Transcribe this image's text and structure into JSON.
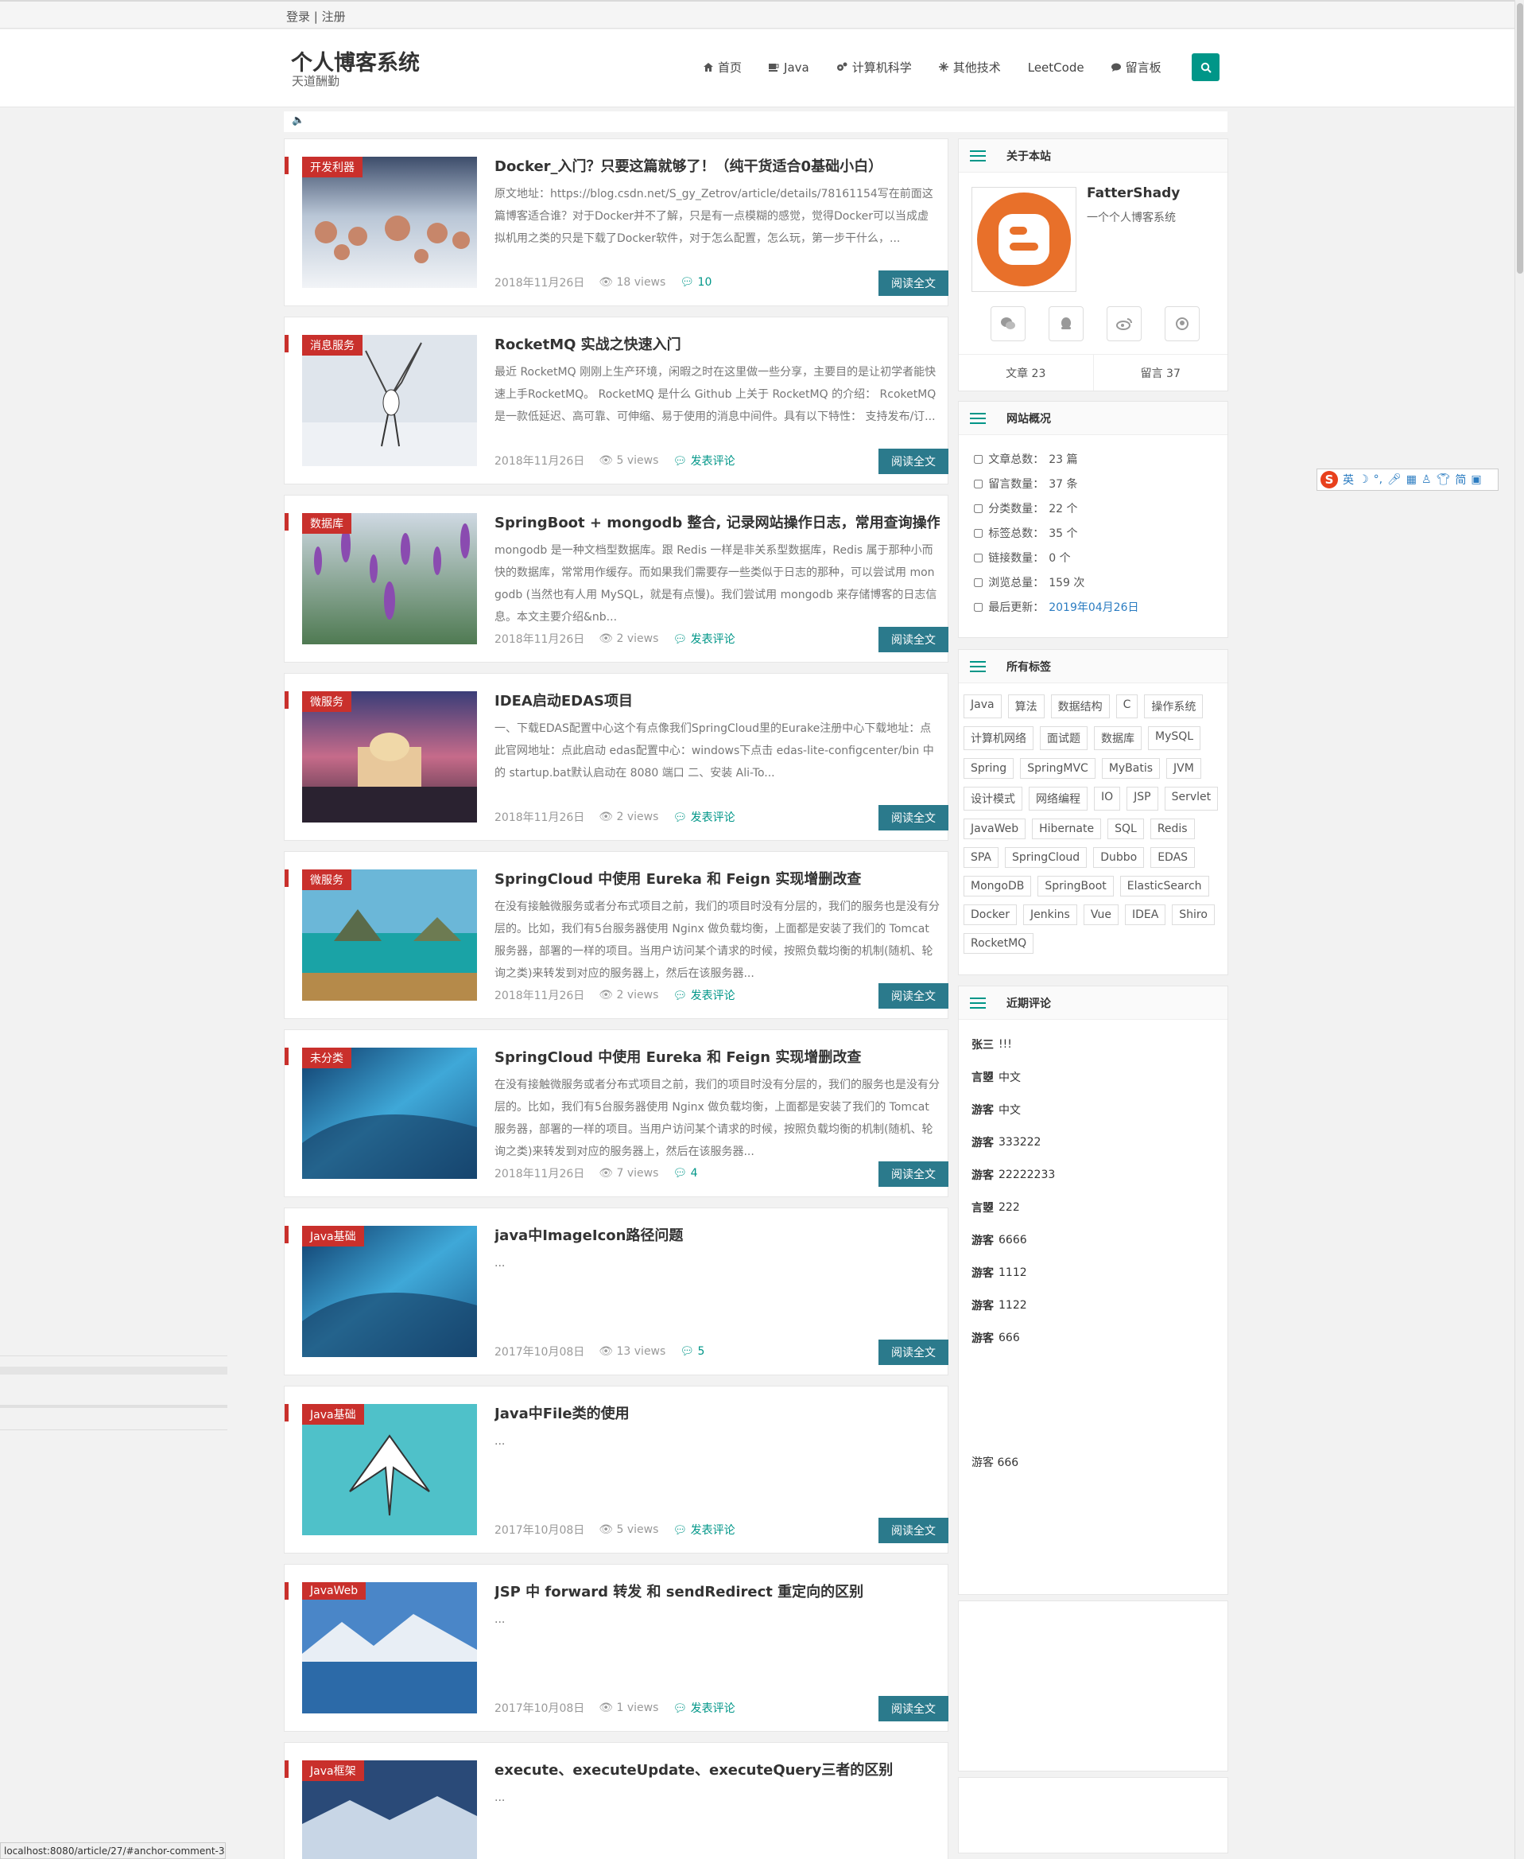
{
  "topbar": {
    "login": "登录",
    "sep": " | ",
    "register": "注册"
  },
  "header": {
    "title": "个人博客系统",
    "subtitle": "天道酬勤"
  },
  "nav": [
    {
      "label": "首页",
      "icon": "home-icon"
    },
    {
      "label": "Java",
      "icon": "coffee-icon"
    },
    {
      "label": "计算机科学",
      "icon": "gears-icon"
    },
    {
      "label": "其他技术",
      "icon": "snowflake-icon"
    },
    {
      "label": "LeetCode",
      "icon": ""
    },
    {
      "label": "留言板",
      "icon": "comment-icon"
    }
  ],
  "posts": [
    {
      "tag": "开发利器",
      "title": "Docker_入门？只要这篇就够了！（纯干货适合0基础小白）",
      "excerpt": "原文地址：https://blog.csdn.net/S_gy_Zetrov/article/details/78161154写在前面这篇博客适合谁？对于Docker并不了解，只是有一点模糊的感觉，觉得Docker可以当成虚拟机用之类的只是下载了Docker软件，对于怎么配置，怎么玩，第一步干什么，...",
      "date": "2018年11月26日",
      "views": "18 views",
      "comments": "10",
      "read": "阅读全文",
      "img": "snowtrees"
    },
    {
      "tag": "消息服务",
      "title": "RocketMQ 实战之快速入门",
      "excerpt": "最近 RocketMQ 刚刚上生产环境，闲暇之时在这里做一些分享，主要目的是让初学者能快速上手RocketMQ。 RocketMQ 是什么 Github 上关于 RocketMQ 的介绍： RcoketMQ 是一款低延迟、高可靠、可伸缩、易于使用的消息中间件。具有以下特性： 支持发布/订...",
      "date": "2018年11月26日",
      "views": "5 views",
      "comments": "发表评论",
      "read": "阅读全文",
      "img": "crane"
    },
    {
      "tag": "数据库",
      "title": "SpringBoot + mongodb 整合, 记录网站操作日志，常用查询操作",
      "excerpt": "mongodb 是一种文档型数据库。跟 Redis 一样是非关系型数据库，Redis 属于那种小而快的数据库，常常用作缓存。而如果我们需要存一些类似于日志的那种，可以尝试用 mongodb (当然也有人用 MySQL，就是有点慢)。我们尝试用 mongodb 来存储博客的日志信息。本文主要介绍&nb...",
      "date": "2018年11月26日",
      "views": "2 views",
      "comments": "发表评论",
      "read": "阅读全文",
      "img": "lavender"
    },
    {
      "tag": "微服务",
      "title": "IDEA启动EDAS项目",
      "excerpt": "一、下载EDAS配置中心这个有点像我们SpringCloud里的Eurake注册中心下载地址：点此官网地址：点此启动 edas配置中心：windows下点击 edas-lite-configcenter/bin 中的 startup.bat默认启动在 8080 端口 二、安装 Ali-To...",
      "date": "2018年11月26日",
      "views": "2 views",
      "comments": "发表评论",
      "read": "阅读全文",
      "img": "city"
    },
    {
      "tag": "微服务",
      "title": "SpringCloud 中使用 Eureka 和 Feign 实现增删改查",
      "excerpt": "在没有接触微服务或者分布式项目之前，我们的项目时没有分层的，我们的服务也是没有分层的。比如，我们有5台服务器使用 Nginx 做负载均衡，上面都是安装了我们的 Tomcat 服务器，部署的一样的项目。当用户访问某个请求的时候，按照负载均衡的机制(随机、轮询之类)来转发到对应的服务器上，然后在该服务器...",
      "date": "2018年11月26日",
      "views": "2 views",
      "comments": "发表评论",
      "read": "阅读全文",
      "img": "bay"
    },
    {
      "tag": "未分类",
      "title": "SpringCloud 中使用 Eureka 和 Feign 实现增删改查",
      "excerpt": "在没有接触微服务或者分布式项目之前，我们的项目时没有分层的，我们的服务也是没有分层的。比如，我们有5台服务器使用 Nginx 做负载均衡，上面都是安装了我们的 Tomcat 服务器，部署的一样的项目。当用户访问某个请求的时候，按照负载均衡的机制(随机、轮询之类)来转发到对应的服务器上，然后在该服务器...",
      "date": "2018年11月26日",
      "views": "7 views",
      "comments": "4",
      "read": "阅读全文",
      "img": "ice"
    },
    {
      "tag": "Java基础",
      "title": "java中ImageIcon路径问题",
      "excerpt": "...",
      "date": "2017年10月08日",
      "views": "13 views",
      "comments": "5",
      "read": "阅读全文",
      "img": "ice"
    },
    {
      "tag": "Java基础",
      "title": "Java中File类的使用",
      "excerpt": "...",
      "date": "2017年10月08日",
      "views": "5 views",
      "comments": "发表评论",
      "read": "阅读全文",
      "img": "bird"
    },
    {
      "tag": "JavaWeb",
      "title": "JSP 中 forward 转发 和 sendRedirect 重定向的区别",
      "excerpt": "...",
      "date": "2017年10月08日",
      "views": "1 views",
      "comments": "发表评论",
      "read": "阅读全文",
      "img": "lake"
    },
    {
      "tag": "Java框架",
      "title": "execute、executeUpdate、executeQuery三者的区别",
      "excerpt": "...",
      "date": "",
      "views": "",
      "comments": "",
      "read": "",
      "img": "mountain"
    }
  ],
  "about": {
    "heading": "关于本站",
    "name": "FatterShady",
    "desc": "一个个人博客系统",
    "articles": "文章 23",
    "messages": "留言 37"
  },
  "overview": {
    "heading": "网站概况",
    "items": [
      {
        "icon": "file-icon",
        "label": "文章总数：",
        "value": "23 篇"
      },
      {
        "icon": "comment-icon",
        "label": "留言数量：",
        "value": "37 条"
      },
      {
        "icon": "folder-icon",
        "label": "分类数量：",
        "value": "22 个"
      },
      {
        "icon": "tags-icon",
        "label": "标签总数：",
        "value": "35 个"
      },
      {
        "icon": "link-icon",
        "label": "链接数量：",
        "value": "0 个"
      },
      {
        "icon": "eye-icon",
        "label": "浏览总量：",
        "value": "159 次"
      },
      {
        "icon": "edit-icon",
        "label": "最后更新：",
        "value": "2019年04月26日"
      }
    ]
  },
  "tags": {
    "heading": "所有标签",
    "items": [
      "Java",
      "算法",
      "数据结构",
      "C",
      "操作系统",
      "计算机网络",
      "面试题",
      "数据库",
      "MySQL",
      "Spring",
      "SpringMVC",
      "MyBatis",
      "JVM",
      "设计模式",
      "网络编程",
      "IO",
      "JSP",
      "Servlet",
      "JavaWeb",
      "Hibernate",
      "SQL",
      "Redis",
      "SPA",
      "SpringCloud",
      "Dubbo",
      "EDAS",
      "MongoDB",
      "SpringBoot",
      "ElasticSearch",
      "Docker",
      "Jenkins",
      "Vue",
      "IDEA",
      "Shiro",
      "RocketMQ"
    ]
  },
  "comments": {
    "heading": "近期评论",
    "items": [
      {
        "user": "张三",
        "text": "!!!"
      },
      {
        "user": "言曌",
        "text": "中文"
      },
      {
        "user": "游客",
        "text": "中文"
      },
      {
        "user": "游客",
        "text": "333222"
      },
      {
        "user": "游客",
        "text": "22222233"
      },
      {
        "user": "言曌",
        "text": "222"
      },
      {
        "user": "游客",
        "text": "6666"
      },
      {
        "user": "游客",
        "text": "1112"
      },
      {
        "user": "游客",
        "text": "1122"
      },
      {
        "user": "游客",
        "text": "666"
      }
    ],
    "extra": "游客 666"
  },
  "ime": {
    "lang": "英"
  },
  "statusbar": "localhost:8080/article/27/#anchor-comment-38"
}
